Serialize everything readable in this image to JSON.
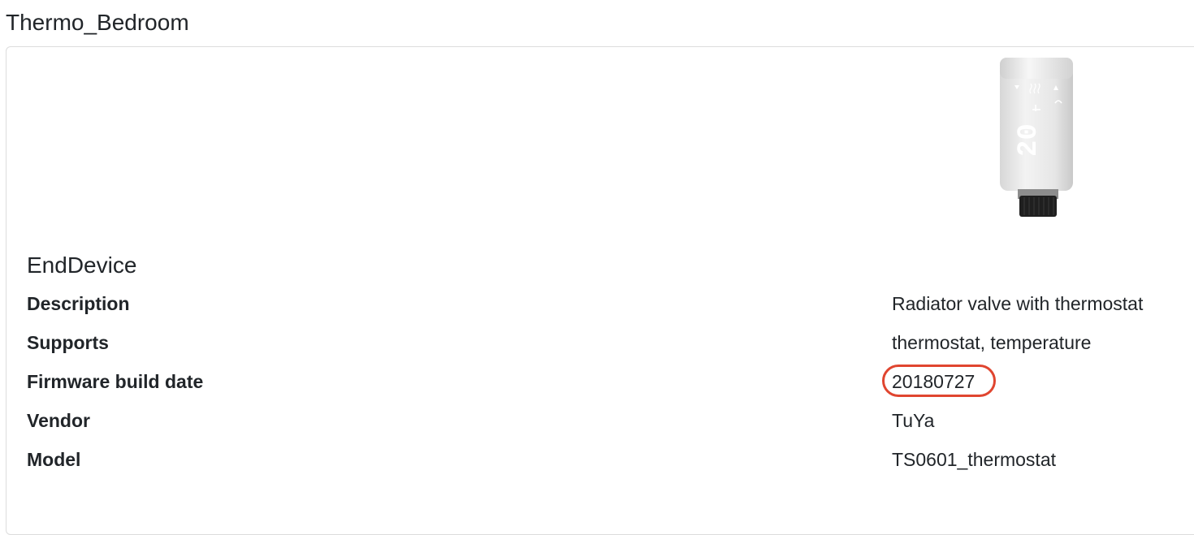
{
  "device": {
    "name": "Thermo_Bedroom",
    "type": "EndDevice",
    "image_icon": "radiator-thermostat-image",
    "display_reading": "20",
    "fields": [
      {
        "label": "Description",
        "value": "Radiator valve with thermostat"
      },
      {
        "label": "Supports",
        "value": "thermostat, temperature"
      },
      {
        "label": "Firmware build date",
        "value": "20180727"
      },
      {
        "label": "Vendor",
        "value": "TuYa"
      },
      {
        "label": "Model",
        "value": "TS0601_thermostat"
      }
    ]
  },
  "annotation": {
    "highlight_color": "#e0452f"
  }
}
